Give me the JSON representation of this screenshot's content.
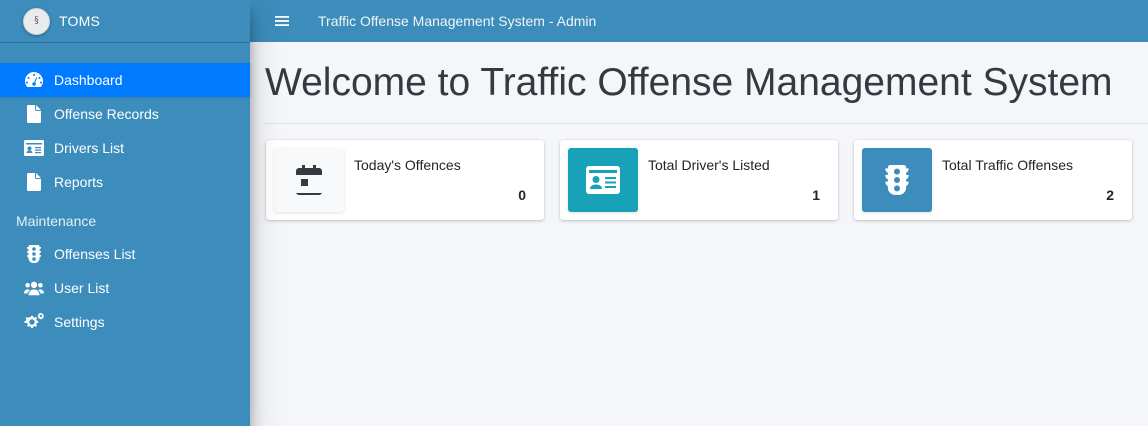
{
  "brand": {
    "name": "TOMS"
  },
  "topbar": {
    "title": "Traffic Offense Management System - Admin"
  },
  "sidebar": {
    "items": [
      {
        "label": "Dashboard",
        "icon": "dashboard-gauge-icon",
        "active": true
      },
      {
        "label": "Offense Records",
        "icon": "file-icon"
      },
      {
        "label": "Drivers List",
        "icon": "id-card-icon"
      },
      {
        "label": "Reports",
        "icon": "file-icon"
      }
    ],
    "maintenance_header": "Maintenance",
    "maintenance_items": [
      {
        "label": "Offenses List",
        "icon": "traffic-light-icon"
      },
      {
        "label": "User List",
        "icon": "users-icon"
      },
      {
        "label": "Settings",
        "icon": "gears-icon"
      }
    ]
  },
  "main": {
    "page_title": "Welcome to Traffic Offense Management System",
    "cards": [
      {
        "label": "Today's Offences",
        "value": "0",
        "icon": "calendar-icon"
      },
      {
        "label": "Total Driver's Listed",
        "value": "1",
        "icon": "id-card-icon"
      },
      {
        "label": "Total Traffic Offenses",
        "value": "2",
        "icon": "traffic-light-icon"
      }
    ]
  },
  "colors": {
    "primary": "#3c8dbc",
    "active": "#007bff",
    "info": "#17a2b8",
    "dark_icon": "#343a40"
  }
}
